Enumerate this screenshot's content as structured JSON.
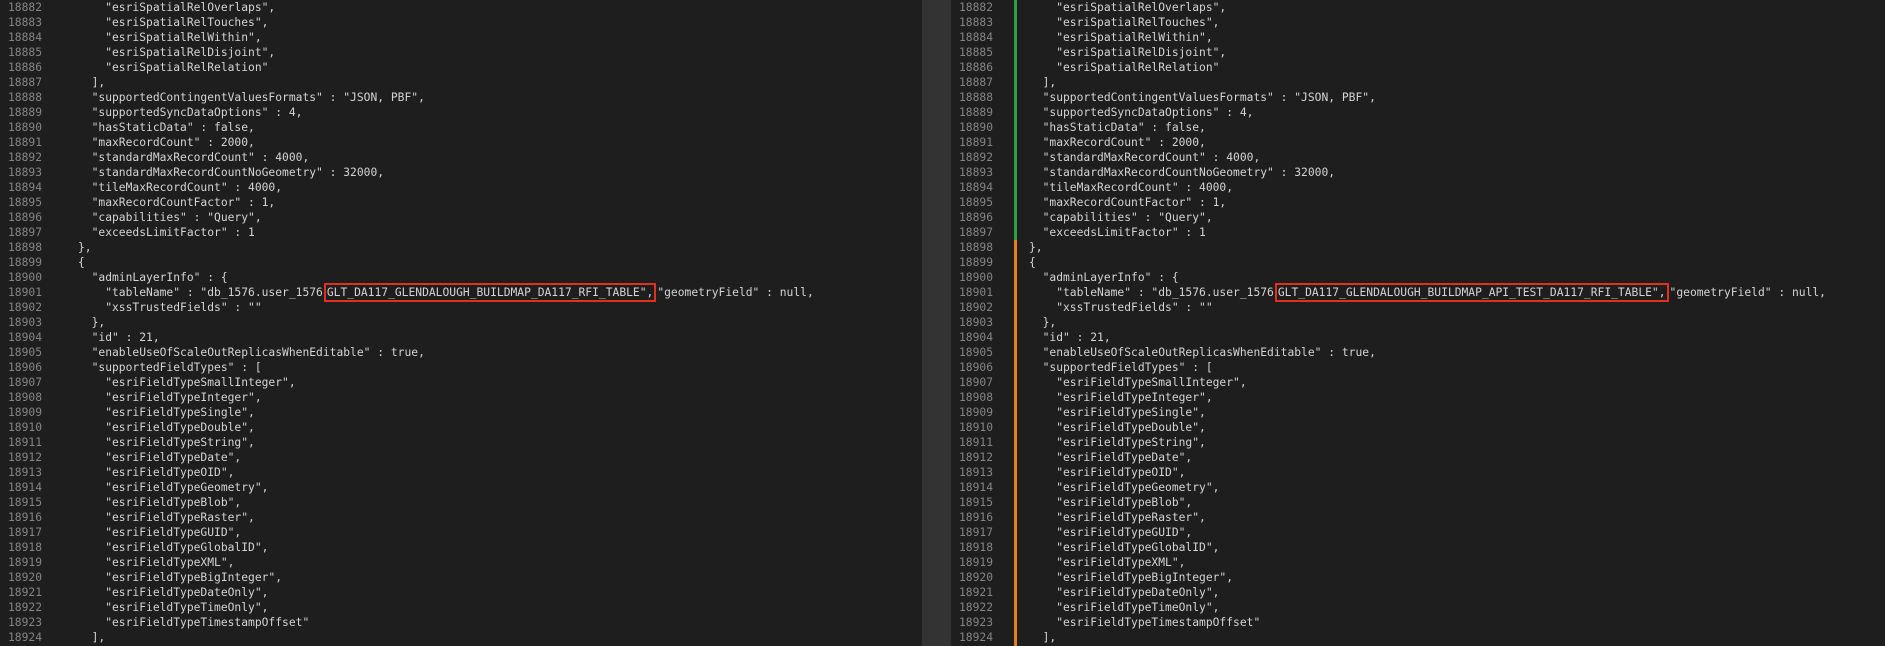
{
  "left_pane": {
    "change_bar_color": "#2ea043",
    "lines": [
      {
        "num": "18882",
        "pre": "    \"esriSpatialRelOverlaps\",",
        "hl": "",
        "post": ""
      },
      {
        "num": "18883",
        "pre": "    \"esriSpatialRelTouches\",",
        "hl": "",
        "post": ""
      },
      {
        "num": "18884",
        "pre": "    \"esriSpatialRelWithin\",",
        "hl": "",
        "post": ""
      },
      {
        "num": "18885",
        "pre": "    \"esriSpatialRelDisjoint\",",
        "hl": "",
        "post": ""
      },
      {
        "num": "18886",
        "pre": "    \"esriSpatialRelRelation\"",
        "hl": "",
        "post": ""
      },
      {
        "num": "18887",
        "pre": "  ],",
        "hl": "",
        "post": ""
      },
      {
        "num": "18888",
        "pre": "  \"supportedContingentValuesFormats\" : \"JSON, PBF\",",
        "hl": "",
        "post": ""
      },
      {
        "num": "18889",
        "pre": "  \"supportedSyncDataOptions\" : 4,",
        "hl": "",
        "post": ""
      },
      {
        "num": "18890",
        "pre": "  \"hasStaticData\" : false,",
        "hl": "",
        "post": ""
      },
      {
        "num": "18891",
        "pre": "  \"maxRecordCount\" : 2000,",
        "hl": "",
        "post": ""
      },
      {
        "num": "18892",
        "pre": "  \"standardMaxRecordCount\" : 4000,",
        "hl": "",
        "post": ""
      },
      {
        "num": "18893",
        "pre": "  \"standardMaxRecordCountNoGeometry\" : 32000,",
        "hl": "",
        "post": ""
      },
      {
        "num": "18894",
        "pre": "  \"tileMaxRecordCount\" : 4000,",
        "hl": "",
        "post": ""
      },
      {
        "num": "18895",
        "pre": "  \"maxRecordCountFactor\" : 1,",
        "hl": "",
        "post": ""
      },
      {
        "num": "18896",
        "pre": "  \"capabilities\" : \"Query\",",
        "hl": "",
        "post": ""
      },
      {
        "num": "18897",
        "pre": "  \"exceedsLimitFactor\" : 1",
        "hl": "",
        "post": ""
      },
      {
        "num": "18898",
        "pre": "},",
        "hl": "",
        "post": ""
      },
      {
        "num": "18899",
        "pre": "{",
        "hl": "",
        "post": ""
      },
      {
        "num": "18900",
        "pre": "  \"adminLayerInfo\" : {",
        "hl": "",
        "post": ""
      },
      {
        "num": "18901",
        "pre": "    \"tableName\" : \"db_1576.user_1576",
        "hl": "GLT_DA117_GLENDALOUGH_BUILDMAP_DA117_RFI_TABLE\",",
        "post": "\"geometryField\" : null,"
      },
      {
        "num": "18902",
        "pre": "    \"xssTrustedFields\" : \"\"",
        "hl": "",
        "post": ""
      },
      {
        "num": "18903",
        "pre": "  },",
        "hl": "",
        "post": ""
      },
      {
        "num": "18904",
        "pre": "  \"id\" : 21,",
        "hl": "",
        "post": ""
      },
      {
        "num": "18905",
        "pre": "  \"enableUseOfScaleOutReplicasWhenEditable\" : true,",
        "hl": "",
        "post": ""
      },
      {
        "num": "18906",
        "pre": "  \"supportedFieldTypes\" : [",
        "hl": "",
        "post": ""
      },
      {
        "num": "18907",
        "pre": "    \"esriFieldTypeSmallInteger\",",
        "hl": "",
        "post": ""
      },
      {
        "num": "18908",
        "pre": "    \"esriFieldTypeInteger\",",
        "hl": "",
        "post": ""
      },
      {
        "num": "18909",
        "pre": "    \"esriFieldTypeSingle\",",
        "hl": "",
        "post": ""
      },
      {
        "num": "18910",
        "pre": "    \"esriFieldTypeDouble\",",
        "hl": "",
        "post": ""
      },
      {
        "num": "18911",
        "pre": "    \"esriFieldTypeString\",",
        "hl": "",
        "post": ""
      },
      {
        "num": "18912",
        "pre": "    \"esriFieldTypeDate\",",
        "hl": "",
        "post": ""
      },
      {
        "num": "18913",
        "pre": "    \"esriFieldTypeOID\",",
        "hl": "",
        "post": ""
      },
      {
        "num": "18914",
        "pre": "    \"esriFieldTypeGeometry\",",
        "hl": "",
        "post": ""
      },
      {
        "num": "18915",
        "pre": "    \"esriFieldTypeBlob\",",
        "hl": "",
        "post": ""
      },
      {
        "num": "18916",
        "pre": "    \"esriFieldTypeRaster\",",
        "hl": "",
        "post": ""
      },
      {
        "num": "18917",
        "pre": "    \"esriFieldTypeGUID\",",
        "hl": "",
        "post": ""
      },
      {
        "num": "18918",
        "pre": "    \"esriFieldTypeGlobalID\",",
        "hl": "",
        "post": ""
      },
      {
        "num": "18919",
        "pre": "    \"esriFieldTypeXML\",",
        "hl": "",
        "post": ""
      },
      {
        "num": "18920",
        "pre": "    \"esriFieldTypeBigInteger\",",
        "hl": "",
        "post": ""
      },
      {
        "num": "18921",
        "pre": "    \"esriFieldTypeDateOnly\",",
        "hl": "",
        "post": ""
      },
      {
        "num": "18922",
        "pre": "    \"esriFieldTypeTimeOnly\",",
        "hl": "",
        "post": ""
      },
      {
        "num": "18923",
        "pre": "    \"esriFieldTypeTimestampOffset\"",
        "hl": "",
        "post": ""
      },
      {
        "num": "18924",
        "pre": "  ],",
        "hl": "",
        "post": ""
      }
    ]
  },
  "right_pane": {
    "change_bar_color": "#e67e22",
    "lines": [
      {
        "num": "18882",
        "pre": "    \"esriSpatialRelOverlaps\",",
        "hl": "",
        "post": ""
      },
      {
        "num": "18883",
        "pre": "    \"esriSpatialRelTouches\",",
        "hl": "",
        "post": ""
      },
      {
        "num": "18884",
        "pre": "    \"esriSpatialRelWithin\",",
        "hl": "",
        "post": ""
      },
      {
        "num": "18885",
        "pre": "    \"esriSpatialRelDisjoint\",",
        "hl": "",
        "post": ""
      },
      {
        "num": "18886",
        "pre": "    \"esriSpatialRelRelation\"",
        "hl": "",
        "post": ""
      },
      {
        "num": "18887",
        "pre": "  ],",
        "hl": "",
        "post": ""
      },
      {
        "num": "18888",
        "pre": "  \"supportedContingentValuesFormats\" : \"JSON, PBF\",",
        "hl": "",
        "post": ""
      },
      {
        "num": "18889",
        "pre": "  \"supportedSyncDataOptions\" : 4,",
        "hl": "",
        "post": ""
      },
      {
        "num": "18890",
        "pre": "  \"hasStaticData\" : false,",
        "hl": "",
        "post": ""
      },
      {
        "num": "18891",
        "pre": "  \"maxRecordCount\" : 2000,",
        "hl": "",
        "post": ""
      },
      {
        "num": "18892",
        "pre": "  \"standardMaxRecordCount\" : 4000,",
        "hl": "",
        "post": ""
      },
      {
        "num": "18893",
        "pre": "  \"standardMaxRecordCountNoGeometry\" : 32000,",
        "hl": "",
        "post": ""
      },
      {
        "num": "18894",
        "pre": "  \"tileMaxRecordCount\" : 4000,",
        "hl": "",
        "post": ""
      },
      {
        "num": "18895",
        "pre": "  \"maxRecordCountFactor\" : 1,",
        "hl": "",
        "post": ""
      },
      {
        "num": "18896",
        "pre": "  \"capabilities\" : \"Query\",",
        "hl": "",
        "post": ""
      },
      {
        "num": "18897",
        "pre": "  \"exceedsLimitFactor\" : 1",
        "hl": "",
        "post": ""
      },
      {
        "num": "18898",
        "pre": "},",
        "hl": "",
        "post": ""
      },
      {
        "num": "18899",
        "pre": "{",
        "hl": "",
        "post": ""
      },
      {
        "num": "18900",
        "pre": "  \"adminLayerInfo\" : {",
        "hl": "",
        "post": ""
      },
      {
        "num": "18901",
        "pre": "    \"tableName\" : \"db_1576.user_1576",
        "hl": "GLT_DA117_GLENDALOUGH_BUILDMAP_API_TEST_DA117_RFI_TABLE\",",
        "post": "\"geometryField\" : null,"
      },
      {
        "num": "18902",
        "pre": "    \"xssTrustedFields\" : \"\"",
        "hl": "",
        "post": ""
      },
      {
        "num": "18903",
        "pre": "  },",
        "hl": "",
        "post": ""
      },
      {
        "num": "18904",
        "pre": "  \"id\" : 21,",
        "hl": "",
        "post": ""
      },
      {
        "num": "18905",
        "pre": "  \"enableUseOfScaleOutReplicasWhenEditable\" : true,",
        "hl": "",
        "post": ""
      },
      {
        "num": "18906",
        "pre": "  \"supportedFieldTypes\" : [",
        "hl": "",
        "post": ""
      },
      {
        "num": "18907",
        "pre": "    \"esriFieldTypeSmallInteger\",",
        "hl": "",
        "post": ""
      },
      {
        "num": "18908",
        "pre": "    \"esriFieldTypeInteger\",",
        "hl": "",
        "post": ""
      },
      {
        "num": "18909",
        "pre": "    \"esriFieldTypeSingle\",",
        "hl": "",
        "post": ""
      },
      {
        "num": "18910",
        "pre": "    \"esriFieldTypeDouble\",",
        "hl": "",
        "post": ""
      },
      {
        "num": "18911",
        "pre": "    \"esriFieldTypeString\",",
        "hl": "",
        "post": ""
      },
      {
        "num": "18912",
        "pre": "    \"esriFieldTypeDate\",",
        "hl": "",
        "post": ""
      },
      {
        "num": "18913",
        "pre": "    \"esriFieldTypeOID\",",
        "hl": "",
        "post": ""
      },
      {
        "num": "18914",
        "pre": "    \"esriFieldTypeGeometry\",",
        "hl": "",
        "post": ""
      },
      {
        "num": "18915",
        "pre": "    \"esriFieldTypeBlob\",",
        "hl": "",
        "post": ""
      },
      {
        "num": "18916",
        "pre": "    \"esriFieldTypeRaster\",",
        "hl": "",
        "post": ""
      },
      {
        "num": "18917",
        "pre": "    \"esriFieldTypeGUID\",",
        "hl": "",
        "post": ""
      },
      {
        "num": "18918",
        "pre": "    \"esriFieldTypeGlobalID\",",
        "hl": "",
        "post": ""
      },
      {
        "num": "18919",
        "pre": "    \"esriFieldTypeXML\",",
        "hl": "",
        "post": ""
      },
      {
        "num": "18920",
        "pre": "    \"esriFieldTypeBigInteger\",",
        "hl": "",
        "post": ""
      },
      {
        "num": "18921",
        "pre": "    \"esriFieldTypeDateOnly\",",
        "hl": "",
        "post": ""
      },
      {
        "num": "18922",
        "pre": "    \"esriFieldTypeTimeOnly\",",
        "hl": "",
        "post": ""
      },
      {
        "num": "18923",
        "pre": "    \"esriFieldTypeTimestampOffset\"",
        "hl": "",
        "post": ""
      },
      {
        "num": "18924",
        "pre": "  ],",
        "hl": "",
        "post": ""
      }
    ]
  }
}
